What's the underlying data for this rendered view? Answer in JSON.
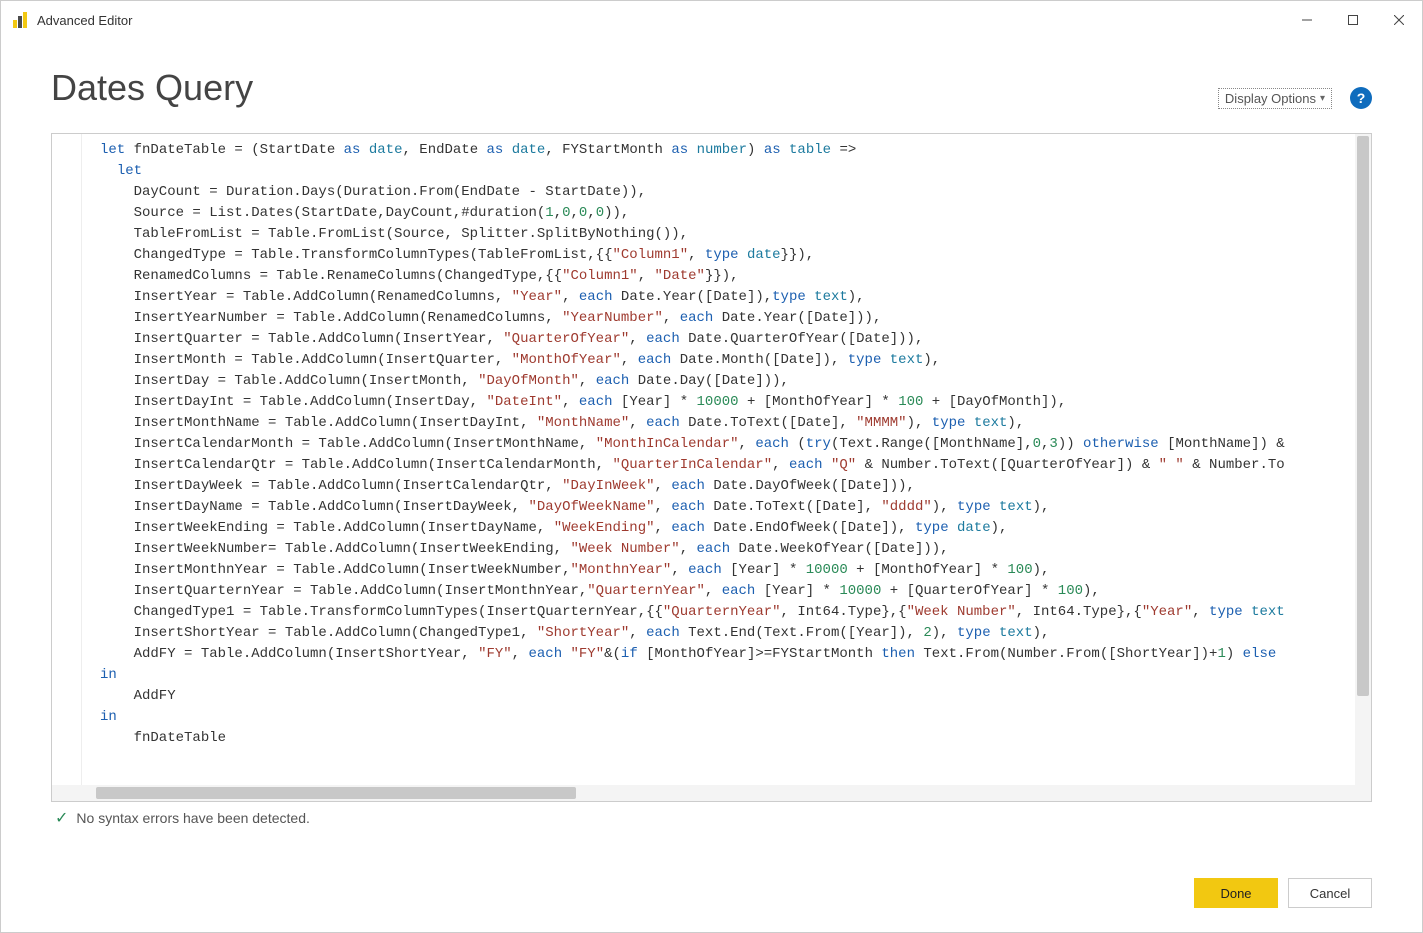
{
  "window": {
    "title": "Advanced Editor",
    "min_label": "—",
    "max_label": "☐",
    "close_label": "✕"
  },
  "header": {
    "query_title": "Dates Query",
    "display_options_label": "Display Options",
    "help_label": "?"
  },
  "status": {
    "message": "No syntax errors have been detected."
  },
  "footer": {
    "done_label": "Done",
    "cancel_label": "Cancel"
  },
  "code": {
    "raw": "let fnDateTable = (StartDate as date, EndDate as date, FYStartMonth as number) as table =>\n  let\n    DayCount = Duration.Days(Duration.From(EndDate - StartDate)),\n    Source = List.Dates(StartDate,DayCount,#duration(1,0,0,0)),\n    TableFromList = Table.FromList(Source, Splitter.SplitByNothing()),\n    ChangedType = Table.TransformColumnTypes(TableFromList,{{\"Column1\", type date}}),\n    RenamedColumns = Table.RenameColumns(ChangedType,{{\"Column1\", \"Date\"}}),\n    InsertYear = Table.AddColumn(RenamedColumns, \"Year\", each Date.Year([Date]),type text),\n    InsertYearNumber = Table.AddColumn(RenamedColumns, \"YearNumber\", each Date.Year([Date])),\n    InsertQuarter = Table.AddColumn(InsertYear, \"QuarterOfYear\", each Date.QuarterOfYear([Date])),\n    InsertMonth = Table.AddColumn(InsertQuarter, \"MonthOfYear\", each Date.Month([Date]), type text),\n    InsertDay = Table.AddColumn(InsertMonth, \"DayOfMonth\", each Date.Day([Date])),\n    InsertDayInt = Table.AddColumn(InsertDay, \"DateInt\", each [Year] * 10000 + [MonthOfYear] * 100 + [DayOfMonth]),\n    InsertMonthName = Table.AddColumn(InsertDayInt, \"MonthName\", each Date.ToText([Date], \"MMMM\"), type text),\n    InsertCalendarMonth = Table.AddColumn(InsertMonthName, \"MonthInCalendar\", each (try(Text.Range([MonthName],0,3)) otherwise [MonthName]) &\n    InsertCalendarQtr = Table.AddColumn(InsertCalendarMonth, \"QuarterInCalendar\", each \"Q\" & Number.ToText([QuarterOfYear]) & \" \" & Number.To\n    InsertDayWeek = Table.AddColumn(InsertCalendarQtr, \"DayInWeek\", each Date.DayOfWeek([Date])),\n    InsertDayName = Table.AddColumn(InsertDayWeek, \"DayOfWeekName\", each Date.ToText([Date], \"dddd\"), type text),\n    InsertWeekEnding = Table.AddColumn(InsertDayName, \"WeekEnding\", each Date.EndOfWeek([Date]), type date),\n    InsertWeekNumber= Table.AddColumn(InsertWeekEnding, \"Week Number\", each Date.WeekOfYear([Date])),\n    InsertMonthnYear = Table.AddColumn(InsertWeekNumber,\"MonthnYear\", each [Year] * 10000 + [MonthOfYear] * 100),\n    InsertQuarternYear = Table.AddColumn(InsertMonthnYear,\"QuarternYear\", each [Year] * 10000 + [QuarterOfYear] * 100),\n    ChangedType1 = Table.TransformColumnTypes(InsertQuarternYear,{{\"QuarternYear\", Int64.Type},{\"Week Number\", Int64.Type},{\"Year\", type text\n    InsertShortYear = Table.AddColumn(ChangedType1, \"ShortYear\", each Text.End(Text.From([Year]), 2), type text),\n    AddFY = Table.AddColumn(InsertShortYear, \"FY\", each \"FY\"&(if [MonthOfYear]>=FYStartMonth then Text.From(Number.From([ShortYear])+1) else\nin\n    AddFY\nin\n    fnDateTable"
  },
  "syntax": {
    "keywords": [
      "let",
      "as",
      "each",
      "type",
      "in",
      "otherwise",
      "if",
      "then",
      "else",
      "try"
    ],
    "types": [
      "date",
      "number",
      "table",
      "text"
    ]
  }
}
